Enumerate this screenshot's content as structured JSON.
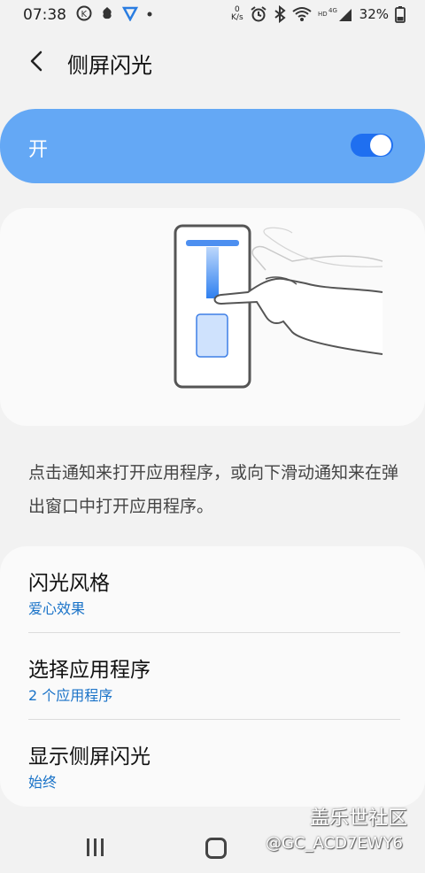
{
  "status_bar": {
    "time": "07:38",
    "left_icons": [
      "k-circle-icon",
      "app-icon",
      "vpn-icon",
      "dot-icon"
    ],
    "net_speed_value": "0",
    "net_speed_unit": "K/s",
    "battery": "32%"
  },
  "header": {
    "title": "侧屏闪光"
  },
  "master_switch": {
    "label": "开",
    "on": true
  },
  "description": "点击通知来打开应用程序，或向下滑动通知来在弹出窗口中打开应用程序。",
  "settings": [
    {
      "title": "闪光风格",
      "value": "爱心效果"
    },
    {
      "title": "选择应用程序",
      "value": "2 个应用程序"
    },
    {
      "title": "显示侧屏闪光",
      "value": "始终"
    }
  ],
  "watermark": {
    "brand": "盖乐世社区",
    "user": "@GC_ACD7EWY6"
  },
  "colors": {
    "accent": "#64a8f5",
    "toggle": "#1f6ff0",
    "link": "#1a73c8"
  }
}
